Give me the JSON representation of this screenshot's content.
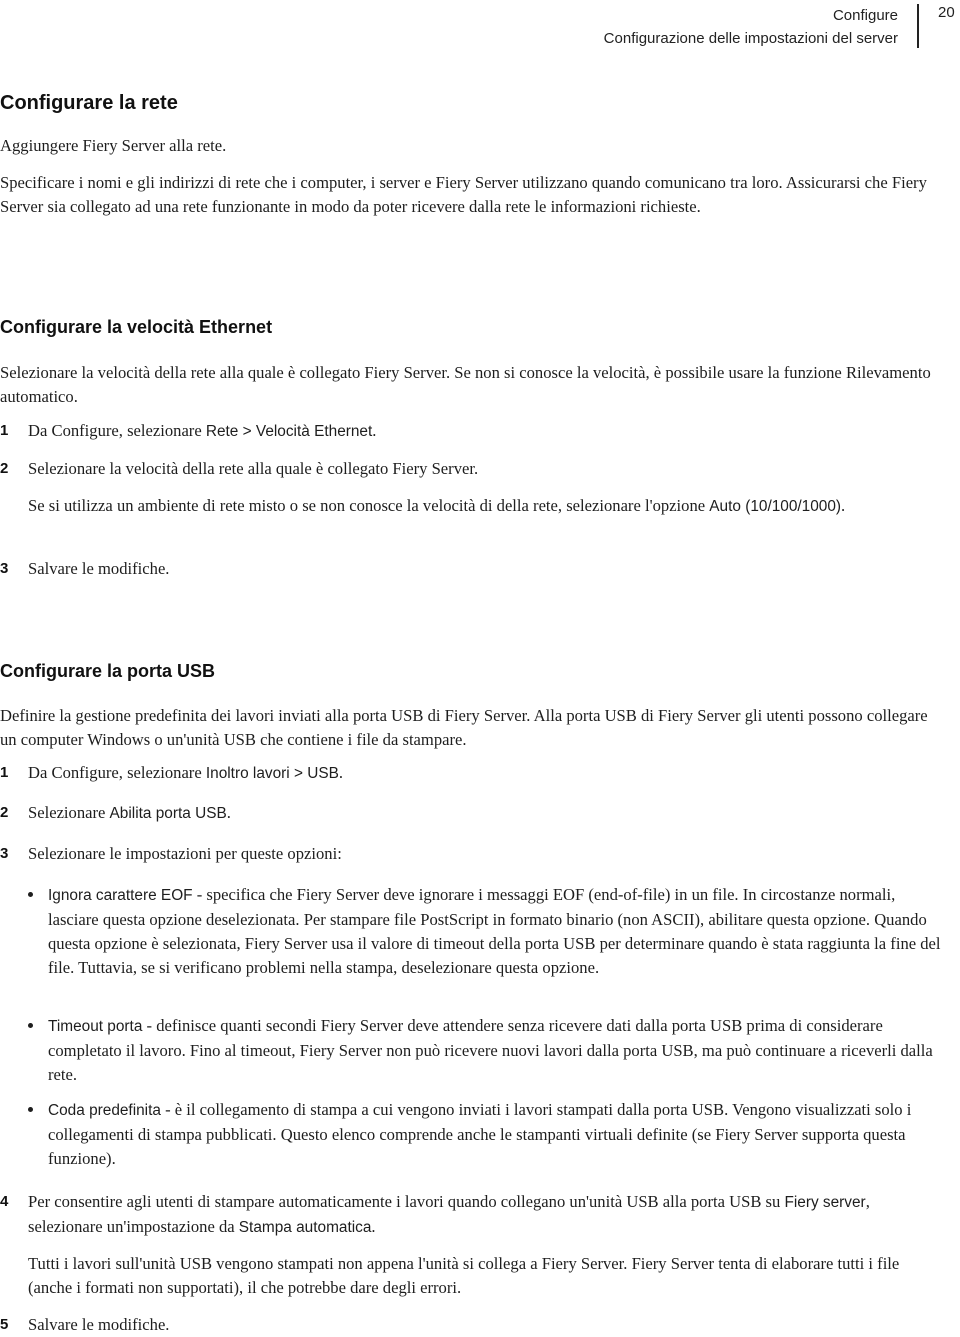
{
  "header": {
    "chapter": "Configure",
    "section": "Configurazione delle impostazioni del server",
    "page_number": "20"
  },
  "section_network": {
    "title": "Configurare la rete",
    "p1": "Aggiungere Fiery Server alla rete.",
    "p2": "Specificare i nomi e gli indirizzi di rete che i computer, i server e Fiery Server utilizzano quando comunicano tra loro. Assicurarsi che Fiery Server sia collegato ad una rete funzionante in modo da poter ricevere dalla rete le informazioni richieste."
  },
  "section_ethernet": {
    "title": "Configurare la velocità Ethernet",
    "intro": "Selezionare la velocità della rete alla quale è collegato Fiery Server. Se non si conosce la velocità, è possibile usare la funzione Rilevamento automatico.",
    "steps": [
      {
        "num": "1",
        "pre": "Da Configure, selezionare ",
        "ui": "Rete > Velocità Ethernet",
        "post": "."
      },
      {
        "num": "2",
        "text": "Selezionare la velocità della rete alla quale è collegato Fiery Server.",
        "note_pre": "Se si utilizza un ambiente di rete misto o se non conosce la velocità di della rete, selezionare l'opzione ",
        "note_ui": "Auto (10/100/1000)",
        "note_post": "."
      },
      {
        "num": "3",
        "text": "Salvare le modifiche."
      }
    ]
  },
  "section_usb": {
    "title": "Configurare la porta USB",
    "intro": "Definire la gestione predefinita dei lavori inviati alla porta USB di Fiery Server. Alla porta USB di Fiery Server gli utenti possono collegare un computer Windows o un'unità USB che contiene i file da stampare.",
    "steps": [
      {
        "num": "1",
        "pre": "Da Configure, selezionare ",
        "ui": "Inoltro lavori > USB",
        "post": "."
      },
      {
        "num": "2",
        "pre": "Selezionare ",
        "ui": "Abilita porta USB",
        "post": "."
      },
      {
        "num": "3",
        "text": "Selezionare le impostazioni per queste opzioni:"
      },
      {
        "num": "4",
        "pre": "Per consentire agli utenti di stampare automaticamente i lavori quando collegano un'unità USB alla porta USB su ",
        "ui": "Fiery server",
        "mid": ", selezionare un'impostazione da ",
        "ui2": "Stampa automatica",
        "post": ".",
        "note": "Tutti i lavori sull'unità USB vengono stampati non appena l'unità si collega a Fiery Server. Fiery Server tenta di elaborare tutti i file (anche i formati non supportati), il che potrebbe dare degli errori."
      },
      {
        "num": "5",
        "text": "Salvare le modifiche."
      }
    ],
    "options": [
      {
        "name": "Ignora carattere EOF",
        "desc": " - specifica che Fiery Server deve ignorare i messaggi EOF (end-of-file) in un file. In circostanze normali, lasciare questa opzione deselezionata. Per stampare file PostScript in formato binario (non ASCII), abilitare questa opzione. Quando questa opzione è selezionata, Fiery Server usa il valore di timeout della porta USB per determinare quando è stata raggiunta la fine del file. Tuttavia, se si verificano problemi nella stampa, deselezionare questa opzione."
      },
      {
        "name": "Timeout porta",
        "desc": " - definisce quanti secondi Fiery Server deve attendere senza ricevere dati dalla porta USB prima di considerare completato il lavoro. Fino al timeout, Fiery Server non può ricevere nuovi lavori dalla porta USB, ma può continuare a riceverli dalla rete."
      },
      {
        "name": "Coda predefinita",
        "desc": " - è il collegamento di stampa a cui vengono inviati i lavori stampati dalla porta USB. Vengono visualizzati solo i collegamenti di stampa pubblicati. Questo elenco comprende anche le stampanti virtuali definite (se Fiery Server supporta questa funzione)."
      }
    ]
  }
}
